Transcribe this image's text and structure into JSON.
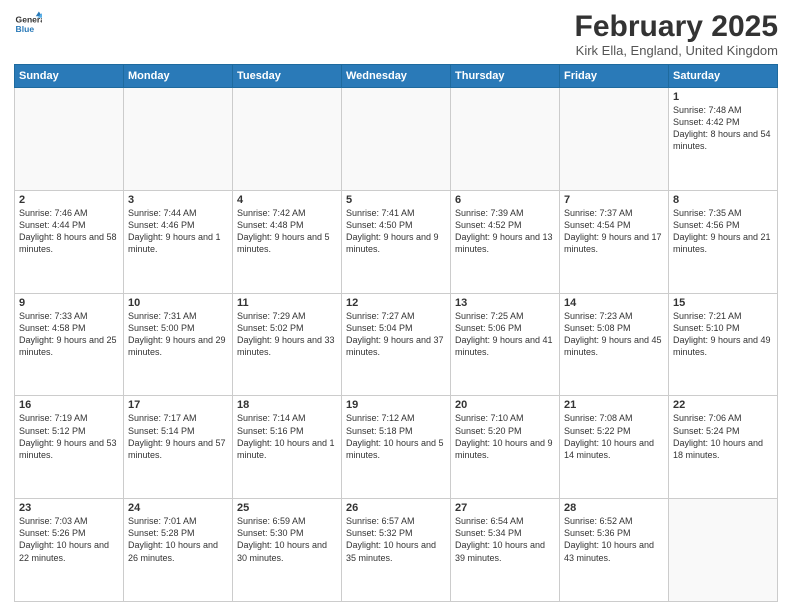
{
  "logo": {
    "general": "General",
    "blue": "Blue"
  },
  "header": {
    "title": "February 2025",
    "location": "Kirk Ella, England, United Kingdom"
  },
  "days_of_week": [
    "Sunday",
    "Monday",
    "Tuesday",
    "Wednesday",
    "Thursday",
    "Friday",
    "Saturday"
  ],
  "weeks": [
    [
      {
        "day": "",
        "info": ""
      },
      {
        "day": "",
        "info": ""
      },
      {
        "day": "",
        "info": ""
      },
      {
        "day": "",
        "info": ""
      },
      {
        "day": "",
        "info": ""
      },
      {
        "day": "",
        "info": ""
      },
      {
        "day": "1",
        "info": "Sunrise: 7:48 AM\nSunset: 4:42 PM\nDaylight: 8 hours and 54 minutes."
      }
    ],
    [
      {
        "day": "2",
        "info": "Sunrise: 7:46 AM\nSunset: 4:44 PM\nDaylight: 8 hours and 58 minutes."
      },
      {
        "day": "3",
        "info": "Sunrise: 7:44 AM\nSunset: 4:46 PM\nDaylight: 9 hours and 1 minute."
      },
      {
        "day": "4",
        "info": "Sunrise: 7:42 AM\nSunset: 4:48 PM\nDaylight: 9 hours and 5 minutes."
      },
      {
        "day": "5",
        "info": "Sunrise: 7:41 AM\nSunset: 4:50 PM\nDaylight: 9 hours and 9 minutes."
      },
      {
        "day": "6",
        "info": "Sunrise: 7:39 AM\nSunset: 4:52 PM\nDaylight: 9 hours and 13 minutes."
      },
      {
        "day": "7",
        "info": "Sunrise: 7:37 AM\nSunset: 4:54 PM\nDaylight: 9 hours and 17 minutes."
      },
      {
        "day": "8",
        "info": "Sunrise: 7:35 AM\nSunset: 4:56 PM\nDaylight: 9 hours and 21 minutes."
      }
    ],
    [
      {
        "day": "9",
        "info": "Sunrise: 7:33 AM\nSunset: 4:58 PM\nDaylight: 9 hours and 25 minutes."
      },
      {
        "day": "10",
        "info": "Sunrise: 7:31 AM\nSunset: 5:00 PM\nDaylight: 9 hours and 29 minutes."
      },
      {
        "day": "11",
        "info": "Sunrise: 7:29 AM\nSunset: 5:02 PM\nDaylight: 9 hours and 33 minutes."
      },
      {
        "day": "12",
        "info": "Sunrise: 7:27 AM\nSunset: 5:04 PM\nDaylight: 9 hours and 37 minutes."
      },
      {
        "day": "13",
        "info": "Sunrise: 7:25 AM\nSunset: 5:06 PM\nDaylight: 9 hours and 41 minutes."
      },
      {
        "day": "14",
        "info": "Sunrise: 7:23 AM\nSunset: 5:08 PM\nDaylight: 9 hours and 45 minutes."
      },
      {
        "day": "15",
        "info": "Sunrise: 7:21 AM\nSunset: 5:10 PM\nDaylight: 9 hours and 49 minutes."
      }
    ],
    [
      {
        "day": "16",
        "info": "Sunrise: 7:19 AM\nSunset: 5:12 PM\nDaylight: 9 hours and 53 minutes."
      },
      {
        "day": "17",
        "info": "Sunrise: 7:17 AM\nSunset: 5:14 PM\nDaylight: 9 hours and 57 minutes."
      },
      {
        "day": "18",
        "info": "Sunrise: 7:14 AM\nSunset: 5:16 PM\nDaylight: 10 hours and 1 minute."
      },
      {
        "day": "19",
        "info": "Sunrise: 7:12 AM\nSunset: 5:18 PM\nDaylight: 10 hours and 5 minutes."
      },
      {
        "day": "20",
        "info": "Sunrise: 7:10 AM\nSunset: 5:20 PM\nDaylight: 10 hours and 9 minutes."
      },
      {
        "day": "21",
        "info": "Sunrise: 7:08 AM\nSunset: 5:22 PM\nDaylight: 10 hours and 14 minutes."
      },
      {
        "day": "22",
        "info": "Sunrise: 7:06 AM\nSunset: 5:24 PM\nDaylight: 10 hours and 18 minutes."
      }
    ],
    [
      {
        "day": "23",
        "info": "Sunrise: 7:03 AM\nSunset: 5:26 PM\nDaylight: 10 hours and 22 minutes."
      },
      {
        "day": "24",
        "info": "Sunrise: 7:01 AM\nSunset: 5:28 PM\nDaylight: 10 hours and 26 minutes."
      },
      {
        "day": "25",
        "info": "Sunrise: 6:59 AM\nSunset: 5:30 PM\nDaylight: 10 hours and 30 minutes."
      },
      {
        "day": "26",
        "info": "Sunrise: 6:57 AM\nSunset: 5:32 PM\nDaylight: 10 hours and 35 minutes."
      },
      {
        "day": "27",
        "info": "Sunrise: 6:54 AM\nSunset: 5:34 PM\nDaylight: 10 hours and 39 minutes."
      },
      {
        "day": "28",
        "info": "Sunrise: 6:52 AM\nSunset: 5:36 PM\nDaylight: 10 hours and 43 minutes."
      },
      {
        "day": "",
        "info": ""
      }
    ]
  ]
}
